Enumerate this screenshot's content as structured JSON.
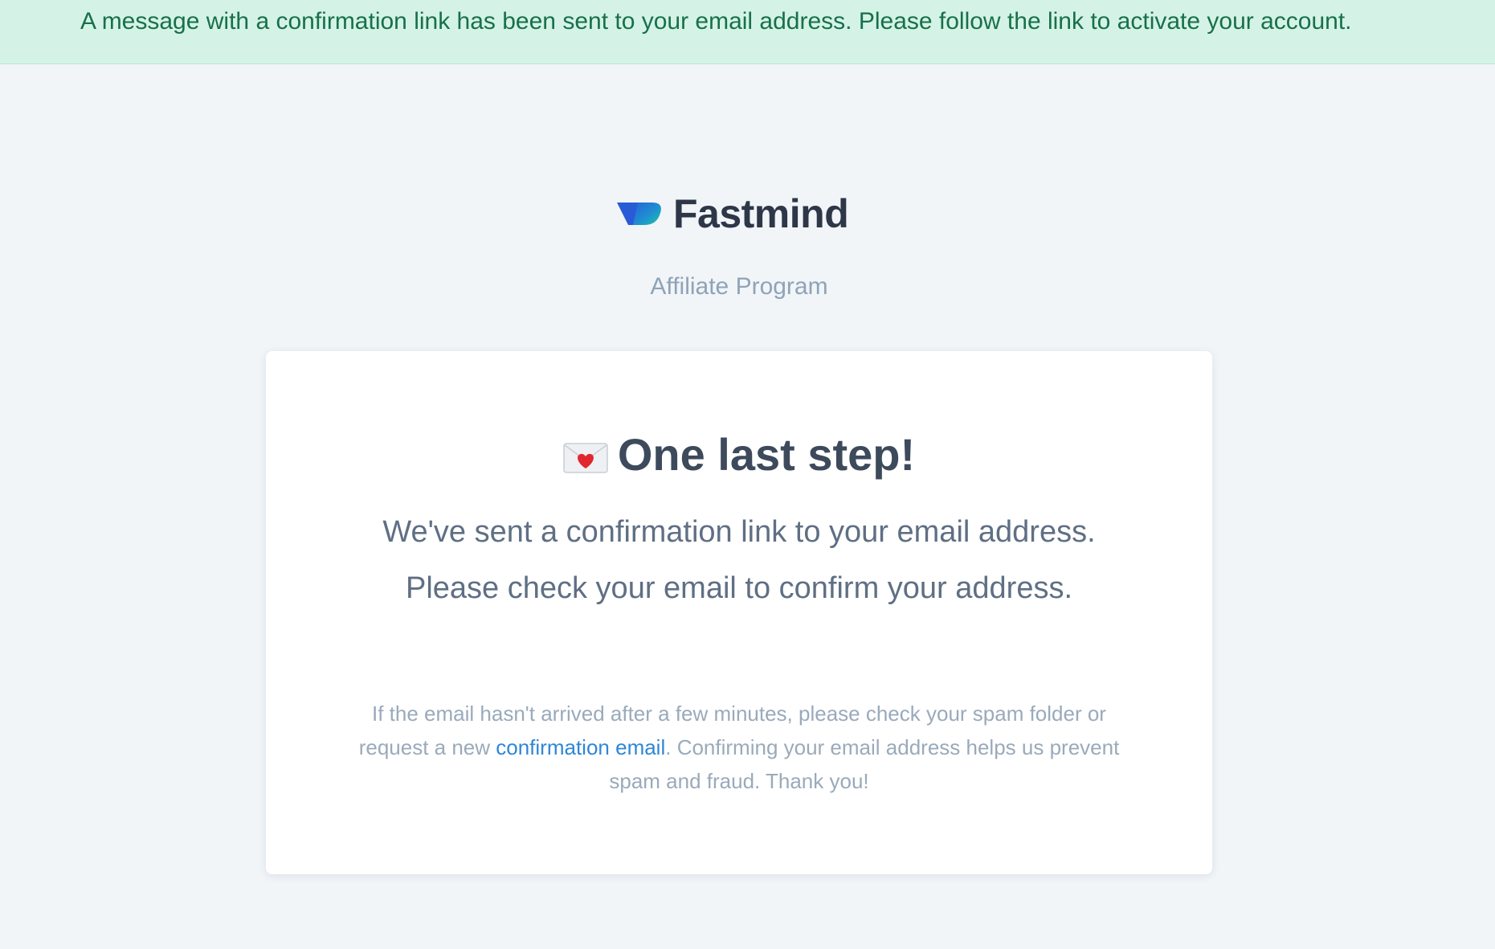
{
  "flash": {
    "message": "A message with a confirmation link has been sent to your email address. Please follow the link to activate your account."
  },
  "logo": {
    "name": "Fastmind",
    "icon": "fastmind-logo-mark"
  },
  "subtitle": "Affiliate Program",
  "card": {
    "title_icon": "love-letter-icon",
    "title": "One last step!",
    "line1": "We've sent a confirmation link to your email address.",
    "line2": "Please check your email to confirm your address.",
    "note_before": "If the email hasn't arrived after a few minutes, please check your spam folder or request a new ",
    "note_link": "confirmation email",
    "note_after": ". Confirming your email address helps us prevent spam and fraud. Thank you!"
  },
  "colors": {
    "flash_bg": "#d4f3e6",
    "flash_text": "#18704a",
    "page_bg": "#f1f5f8",
    "link": "#2f86d6",
    "logo_blue": "#2563d9",
    "logo_teal": "#19c7a8"
  }
}
